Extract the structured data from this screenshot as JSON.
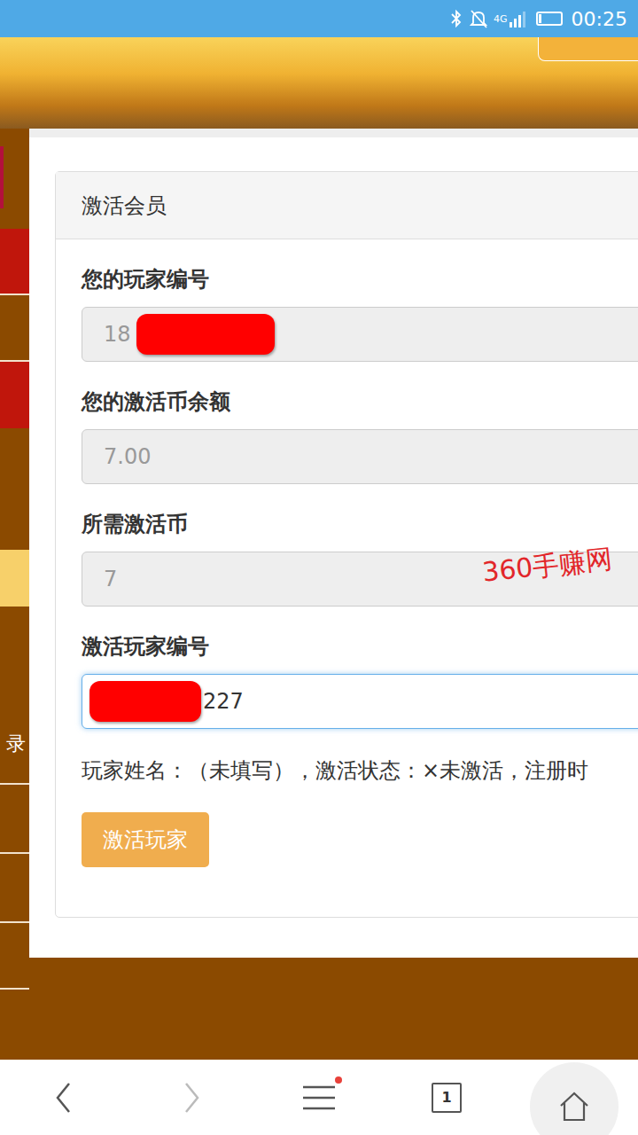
{
  "status_bar": {
    "bluetooth": true,
    "muted": true,
    "network": "4G",
    "signal_level": 0.75,
    "battery_level": 0.1,
    "time": "00:25"
  },
  "sidebar": {
    "items": [
      {
        "label": "录"
      }
    ]
  },
  "panel": {
    "title": "激活会员",
    "fields": [
      {
        "label": "您的玩家编号",
        "value": "18",
        "redaction": "after",
        "editable": false,
        "focused": false
      },
      {
        "label": "您的激活币余额",
        "value": "7.00",
        "redaction": "none",
        "editable": false,
        "focused": false
      },
      {
        "label": "所需激活币",
        "value": "7",
        "redaction": "none",
        "editable": false,
        "focused": false
      },
      {
        "label": "激活玩家编号",
        "value": "227",
        "redaction": "before",
        "editable": true,
        "focused": true
      }
    ],
    "info": "玩家姓名：（未填写），激活状态：×未激活，注册时",
    "button": "激活玩家"
  },
  "watermark": "360手赚网",
  "nav_bar": {
    "back_enabled": true,
    "forward_enabled": false,
    "menu_badge": true,
    "tab_count": "1"
  }
}
